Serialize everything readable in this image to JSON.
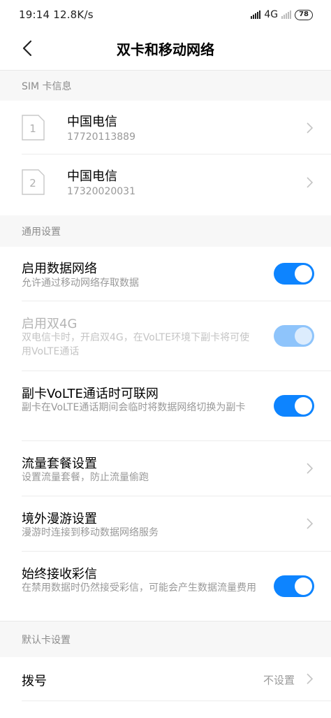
{
  "status_bar": {
    "time": "19:14",
    "speed": "12.8K/s",
    "network": "4G",
    "battery": "78"
  },
  "header": {
    "title": "双卡和移动网络"
  },
  "sim_section": {
    "header": "SIM 卡信息",
    "cards": [
      {
        "slot": "1",
        "carrier": "中国电信",
        "number": "17720113889"
      },
      {
        "slot": "2",
        "carrier": "中国电信",
        "number": "17320020031"
      }
    ]
  },
  "general_section": {
    "header": "通用设置",
    "items": [
      {
        "title": "启用数据网络",
        "desc": "允许通过移动网络存取数据",
        "toggle": true,
        "enabled": true
      },
      {
        "title": "启用双4G",
        "desc": "双电信卡时，开启双4G，在VoLTE环境下副卡将可使用VoLTE通话",
        "toggle": true,
        "enabled": false
      },
      {
        "title": "副卡VoLTE通话时可联网",
        "desc": "副卡在VoLTE通话期间会临时将数据网络切换为副卡",
        "toggle": true,
        "enabled": true
      },
      {
        "title": "流量套餐设置",
        "desc": "设置流量套餐，防止流量偷跑"
      },
      {
        "title": "境外漫游设置",
        "desc": "漫游时连接到移动数据网络服务"
      },
      {
        "title": "始终接收彩信",
        "desc": "在禁用数据时仍然接受彩信，可能会产生数据流量费用",
        "toggle": true,
        "enabled": true
      }
    ]
  },
  "default_section": {
    "header": "默认卡设置",
    "items": [
      {
        "title": "拨号",
        "value": "不设置"
      }
    ]
  },
  "colors": {
    "accent": "#0d84ff",
    "accent_disabled": "#8ec4fb",
    "section_bg": "#f7f7f7",
    "secondary_text": "#999999"
  }
}
